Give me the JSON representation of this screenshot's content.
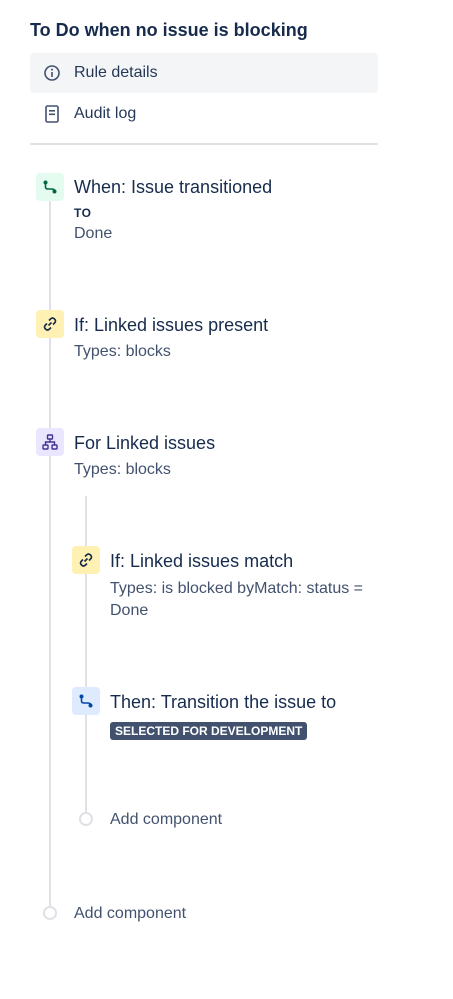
{
  "rule": {
    "title": "To Do when no issue is blocking"
  },
  "nav": {
    "items": [
      {
        "label": "Rule details",
        "icon": "info-icon"
      },
      {
        "label": "Audit log",
        "icon": "document-icon"
      }
    ]
  },
  "components": {
    "trigger": {
      "title": "When: Issue transitioned",
      "to_label": "TO",
      "to_value": "Done",
      "icon": "transition-icon",
      "color": "#E3FCEF"
    },
    "condition1": {
      "title": "If: Linked issues present",
      "sub": "Types: blocks",
      "icon": "link-icon",
      "color": "#FFF0B3"
    },
    "branch": {
      "title": "For Linked issues",
      "sub": "Types: blocks",
      "icon": "branch-icon",
      "color": "#EAE6FF"
    },
    "condition2": {
      "title": "If: Linked issues match",
      "sub": "Types: is blocked byMatch: status = Done",
      "icon": "link-icon",
      "color": "#FFF0B3"
    },
    "action": {
      "title": "Then: Transition the issue to",
      "status": "SELECTED FOR DEVELOPMENT",
      "icon": "transition-icon",
      "color": "#DEEBFF"
    },
    "add_inner": {
      "label": "Add component"
    },
    "add_outer": {
      "label": "Add component"
    }
  }
}
